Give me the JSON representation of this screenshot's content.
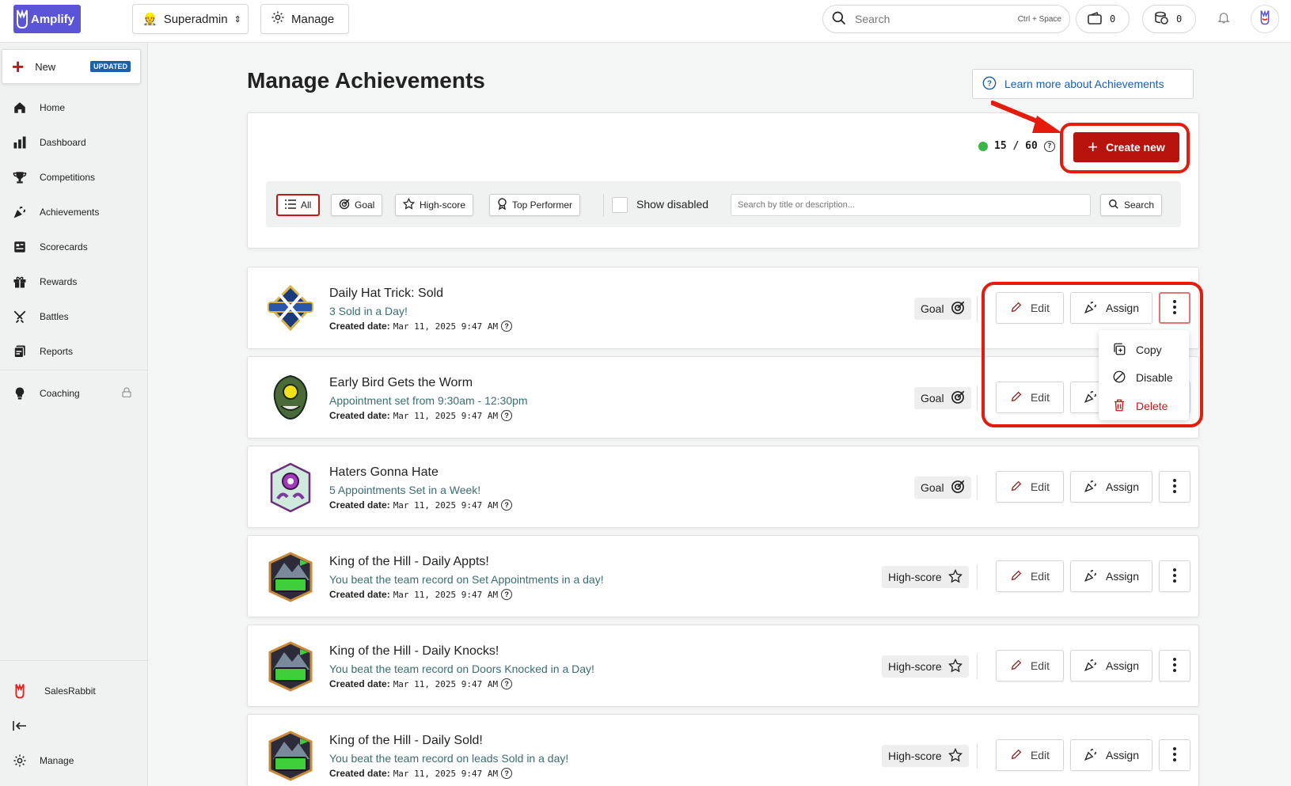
{
  "topbar": {
    "logo_text": "Amplify",
    "role": "Superadmin",
    "manage": "Manage",
    "search_placeholder": "Search",
    "search_shortcut": "Ctrl + Space",
    "counter1": "0",
    "counter2": "0"
  },
  "sidebar": {
    "new_label": "New",
    "updated_badge": "UPDATED",
    "items": [
      {
        "label": "Home",
        "icon": "home-icon"
      },
      {
        "label": "Dashboard",
        "icon": "bar-chart-icon"
      },
      {
        "label": "Competitions",
        "icon": "trophy-icon"
      },
      {
        "label": "Achievements",
        "icon": "confetti-icon"
      },
      {
        "label": "Scorecards",
        "icon": "scorecard-icon"
      },
      {
        "label": "Rewards",
        "icon": "gift-icon"
      },
      {
        "label": "Battles",
        "icon": "swords-icon"
      },
      {
        "label": "Reports",
        "icon": "reports-icon"
      }
    ],
    "coaching": "Coaching",
    "org": "SalesRabbit",
    "manage": "Manage"
  },
  "page": {
    "title": "Manage Achievements",
    "learn_more": "Learn more about Achievements",
    "count": "15 / 60",
    "create_new": "Create new"
  },
  "filters": {
    "all": "All",
    "goal": "Goal",
    "high_score": "High-score",
    "top_performer": "Top Performer",
    "show_disabled": "Show disabled",
    "search_placeholder": "Search by title or description...",
    "search_button": "Search"
  },
  "common": {
    "created_label": "Created date:",
    "edit": "Edit",
    "assign": "Assign"
  },
  "achievements": [
    {
      "title": "Daily Hat Trick: Sold",
      "description": "3 Sold in a Day!",
      "date": "Mar 11, 2025 9:47 AM",
      "type": "Goal"
    },
    {
      "title": "Early Bird Gets the Worm",
      "description": "Appointment set from 9:30am - 12:30pm",
      "date": "Mar 11, 2025 9:47 AM",
      "type": "Goal"
    },
    {
      "title": "Haters Gonna Hate",
      "description": "5 Appointments Set in a Week!",
      "date": "Mar 11, 2025 9:47 AM",
      "type": "Goal"
    },
    {
      "title": "King of the Hill - Daily Appts!",
      "description": "You beat the team record on Set Appointments in a day!",
      "date": "Mar 11, 2025 9:47 AM",
      "type": "High-score"
    },
    {
      "title": "King of the Hill - Daily Knocks!",
      "description": "You beat the team record on Doors Knocked in a Day!",
      "date": "Mar 11, 2025 9:47 AM",
      "type": "High-score"
    },
    {
      "title": "King of the Hill - Daily Sold!",
      "description": "You beat the team record on leads Sold in a day!",
      "date": "Mar 11, 2025 9:47 AM",
      "type": "High-score"
    }
  ],
  "menu": {
    "copy": "Copy",
    "disable": "Disable",
    "delete": "Delete"
  },
  "colors": {
    "brand": "#5a55d6",
    "primary": "#b8140e",
    "annotation": "#e31c0d",
    "link": "#1d5fa8"
  }
}
